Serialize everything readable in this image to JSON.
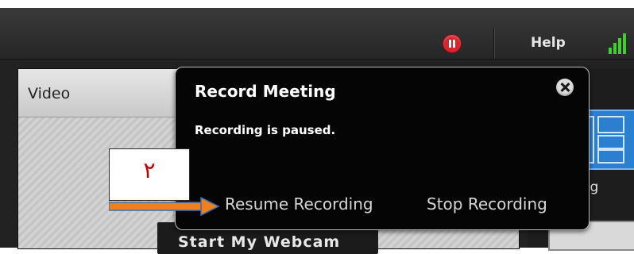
{
  "topbar": {
    "help_label": "Help",
    "record_icon": "pause-recording-icon",
    "signal_icon": "signal-strength-icon",
    "colors": {
      "record": "#d8242a",
      "signal": "#3fcf2c"
    }
  },
  "video_pod": {
    "title": "Video",
    "webcam_button_label": "Start My Webcam"
  },
  "right_panel": {
    "sharing_label": "Sharing"
  },
  "record_popup": {
    "title": "Record Meeting",
    "status": "Recording is paused.",
    "resume_label": "Resume Recording",
    "stop_label": "Stop Recording",
    "close_icon": "close-icon"
  },
  "annotation": {
    "step_number": "٢",
    "arrow_color": "#f07f1d"
  }
}
